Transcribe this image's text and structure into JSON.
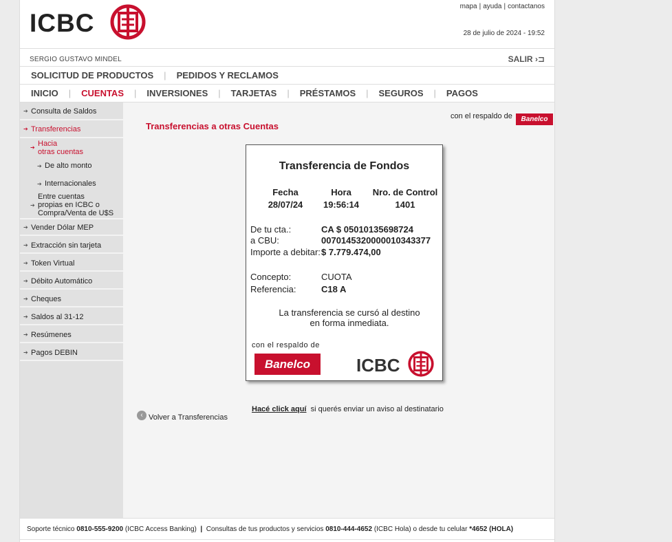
{
  "brand": {
    "logo_text": "ICBC"
  },
  "top_links": [
    "mapa",
    "ayuda",
    "contactanos"
  ],
  "datetime": "28 de julio de 2024 - 19:52",
  "user": {
    "name": "SERGIO GUSTAVO MINDEL",
    "logout_label": "SALIR"
  },
  "nav_primary": [
    "SOLICITUD DE PRODUCTOS",
    "PEDIDOS Y RECLAMOS"
  ],
  "nav_secondary": {
    "items": [
      "INICIO",
      "CUENTAS",
      "INVERSIONES",
      "TARJETAS",
      "PRÉSTAMOS",
      "SEGUROS",
      "PAGOS"
    ],
    "active": "CUENTAS"
  },
  "sidebar": {
    "consulta": "Consulta de Saldos",
    "transferencias": "Transferencias",
    "hacia_line1": "Hacia",
    "hacia_line2": "otras cuentas",
    "alto_monto": "De alto monto",
    "internacionales": "Internacionales",
    "entre_line1": "Entre cuentas",
    "entre_line2": "propias en ICBC o",
    "entre_line3": "Compra/Venta de U$S",
    "vender": "Vender Dólar MEP",
    "extraccion": "Extracción sin tarjeta",
    "token": "Token Virtual",
    "debito": "Débito Automático",
    "cheques": "Cheques",
    "saldos": "Saldos al 31-12",
    "resumenes": "Resúmenes",
    "debin": "Pagos DEBIN"
  },
  "respaldo_label": "con el respaldo de",
  "banelco_label": "Banelco",
  "section_title": "Transferencias a otras Cuentas",
  "receipt": {
    "title": "Transferencia de Fondos",
    "fecha_label": "Fecha",
    "fecha": "28/07/24",
    "hora_label": "Hora",
    "hora": "19:56:14",
    "control_label": "Nro. de Control",
    "control": "1401",
    "cta_label": "De tu cta.:",
    "cta": "CA $ 05010135698724",
    "cbu_label": "a CBU:",
    "cbu": "0070145320000010343377",
    "importe_label": "Importe a debitar:",
    "importe": "$ 7.779.474,00",
    "concepto_label": "Concepto:",
    "concepto": "CUOTA",
    "referencia_label": "Referencia:",
    "referencia": "C18 A",
    "note_line1": "La transferencia se cursó al destino",
    "note_line2": "en forma inmediata.",
    "respaldo": "con el respaldo de",
    "banelco": "Banelco",
    "icbc": "ICBC"
  },
  "notify": {
    "link": "Hacé click aquí",
    "text": "si querés enviar un aviso al destinatario"
  },
  "back_label": "Volver a Transferencias",
  "footer": {
    "p1": "Soporte técnico",
    "phone1": "0810-555-9200",
    "p2": "(ICBC Access Banking)",
    "sep": "|",
    "p3": "Consultas de tus productos y servicios",
    "phone2": "0810-444-4652",
    "p4": "(ICBC Hola) o desde tu celular",
    "phone3": "*4652 (HOLA)"
  },
  "colors": {
    "brand_red": "#c8102e"
  }
}
